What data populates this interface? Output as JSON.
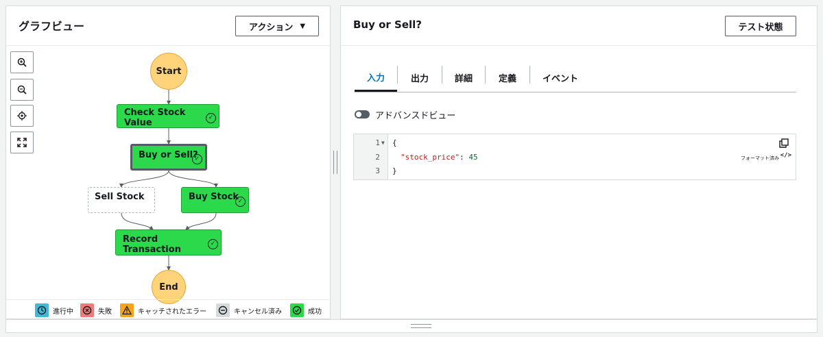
{
  "left_panel": {
    "title": "グラフビュー",
    "action_button": "アクション",
    "zoom_controls": [
      "zoom-in-icon",
      "zoom-out-icon",
      "center-icon",
      "fit-icon"
    ],
    "nodes": {
      "start": "Start",
      "check_stock": "Check Stock Value",
      "buy_or_sell": "Buy or Sell?",
      "sell_stock": "Sell Stock",
      "buy_stock": "Buy Stock",
      "record_transaction": "Record Transaction",
      "end": "End"
    },
    "legend": {
      "in_progress": "進行中",
      "failed": "失敗",
      "caught_error": "キャッチされたエラー",
      "cancelled": "キャンセル済み",
      "succeeded": "成功"
    }
  },
  "right_panel": {
    "title": "Buy or Sell?",
    "test_button": "テスト状態",
    "tabs": [
      "入力",
      "出力",
      "詳細",
      "定義",
      "イベント"
    ],
    "active_tab": "入力",
    "toggle_label": "アドバンスドビュー",
    "editor": {
      "line_numbers": [
        "1",
        "2",
        "3"
      ],
      "lines": [
        "{",
        "\"stock_price\": 45",
        "}"
      ],
      "json_key": "\"stock_price\"",
      "json_value": "45",
      "format_label": "フォーマット済み"
    }
  },
  "colors": {
    "success": "#2bd94a",
    "start_end": "#ffd37a",
    "in_progress": "#44b9d6",
    "failed": "#f07a7a",
    "caught_error": "#f7a31d",
    "cancelled": "#d5dbdb",
    "active_tab": "#0073bb"
  }
}
